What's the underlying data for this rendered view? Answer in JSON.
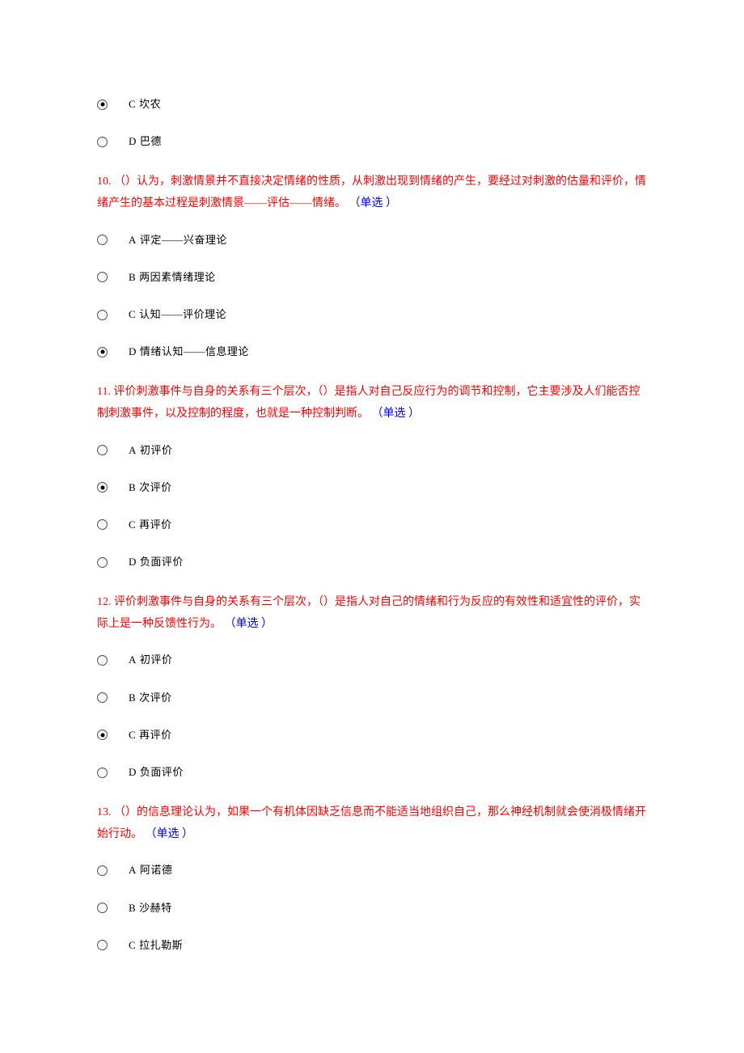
{
  "preOptions": [
    {
      "letter": "C",
      "text": "坎农",
      "selected": true
    },
    {
      "letter": "D",
      "text": "巴德",
      "selected": false
    }
  ],
  "questions": [
    {
      "num": "10.",
      "text": "（）认为，刺激情景并不直接决定情绪的性质，从刺激出现到情绪的产生，要经过对刺激的估量和评价，情绪产生的基本过程是刺激情景——评估——情绪。",
      "type": "（单选 ）",
      "options": [
        {
          "letter": "A",
          "text": "评定——兴奋理论",
          "selected": false
        },
        {
          "letter": "B",
          "text": "两因素情绪理论",
          "selected": false
        },
        {
          "letter": "C",
          "text": "认知——评价理论",
          "selected": false
        },
        {
          "letter": "D",
          "text": "情绪认知——信息理论",
          "selected": true
        }
      ]
    },
    {
      "num": "11.",
      "text": "评价刺激事件与自身的关系有三个层次，（）是指人对自己反应行为的调节和控制，它主要涉及人们能否控制刺激事件，以及控制的程度，也就是一种控制判断。",
      "type": "（单选 ）",
      "options": [
        {
          "letter": "A",
          "text": "初评价",
          "selected": false
        },
        {
          "letter": "B",
          "text": "次评价",
          "selected": true
        },
        {
          "letter": "C",
          "text": "再评价",
          "selected": false
        },
        {
          "letter": "D",
          "text": "负面评价",
          "selected": false
        }
      ]
    },
    {
      "num": "12.",
      "text": "评价刺激事件与自身的关系有三个层次，（）是指人对自己的情绪和行为反应的有效性和适宜性的评价，实际上是一种反馈性行为。",
      "type": "（单选 ）",
      "options": [
        {
          "letter": "A",
          "text": "初评价",
          "selected": false
        },
        {
          "letter": "B",
          "text": "次评价",
          "selected": false
        },
        {
          "letter": "C",
          "text": "再评价",
          "selected": true
        },
        {
          "letter": "D",
          "text": "负面评价",
          "selected": false
        }
      ]
    },
    {
      "num": "13.",
      "text": "（）的信息理论认为，如果一个有机体因缺乏信息而不能适当地组织自己，那么神经机制就会使消极情绪开始行动。",
      "type": "（单选 ）",
      "options": [
        {
          "letter": "A",
          "text": "阿诺德",
          "selected": false
        },
        {
          "letter": "B",
          "text": "沙赫特",
          "selected": false
        },
        {
          "letter": "C",
          "text": "拉扎勒斯",
          "selected": false
        }
      ]
    }
  ]
}
